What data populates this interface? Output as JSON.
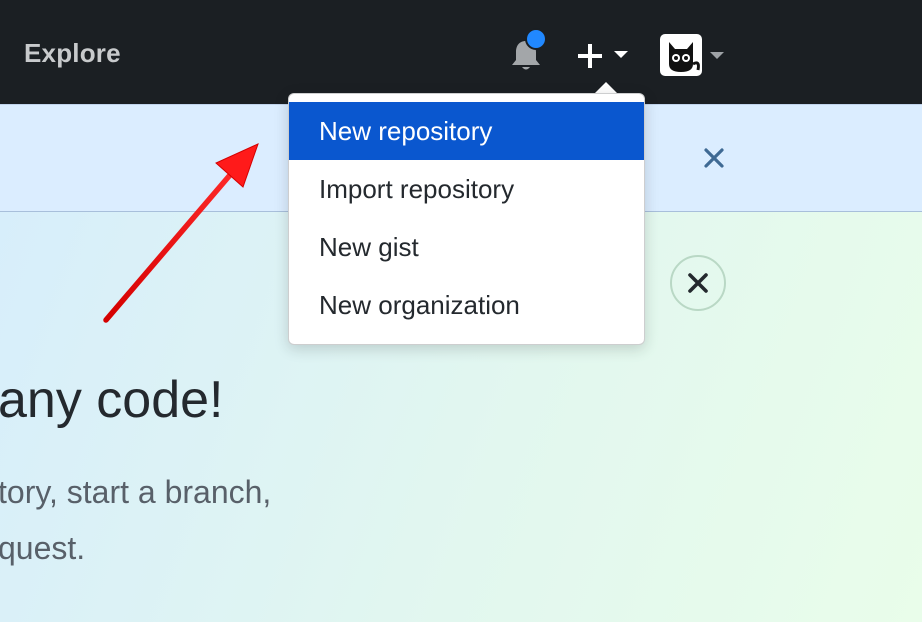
{
  "header": {
    "explore_label": "Explore",
    "icons": {
      "notifications": "bell-icon",
      "create_new": "plus-icon",
      "user_menu": "avatar-icon"
    }
  },
  "dropdown": {
    "items": [
      {
        "label": "New repository",
        "active": true
      },
      {
        "label": "Import repository",
        "active": false
      },
      {
        "label": "New gist",
        "active": false
      },
      {
        "label": "New organization",
        "active": false
      }
    ]
  },
  "main": {
    "heading": "any code!",
    "line1": "tory, start a branch,",
    "line2": "quest."
  },
  "colors": {
    "header_bg": "#1b1f23",
    "banner_bg": "#dbedff",
    "active_item_bg": "#0a57cf",
    "notification_dot": "#2188ff",
    "annotation_arrow": "#ff1a1a"
  }
}
